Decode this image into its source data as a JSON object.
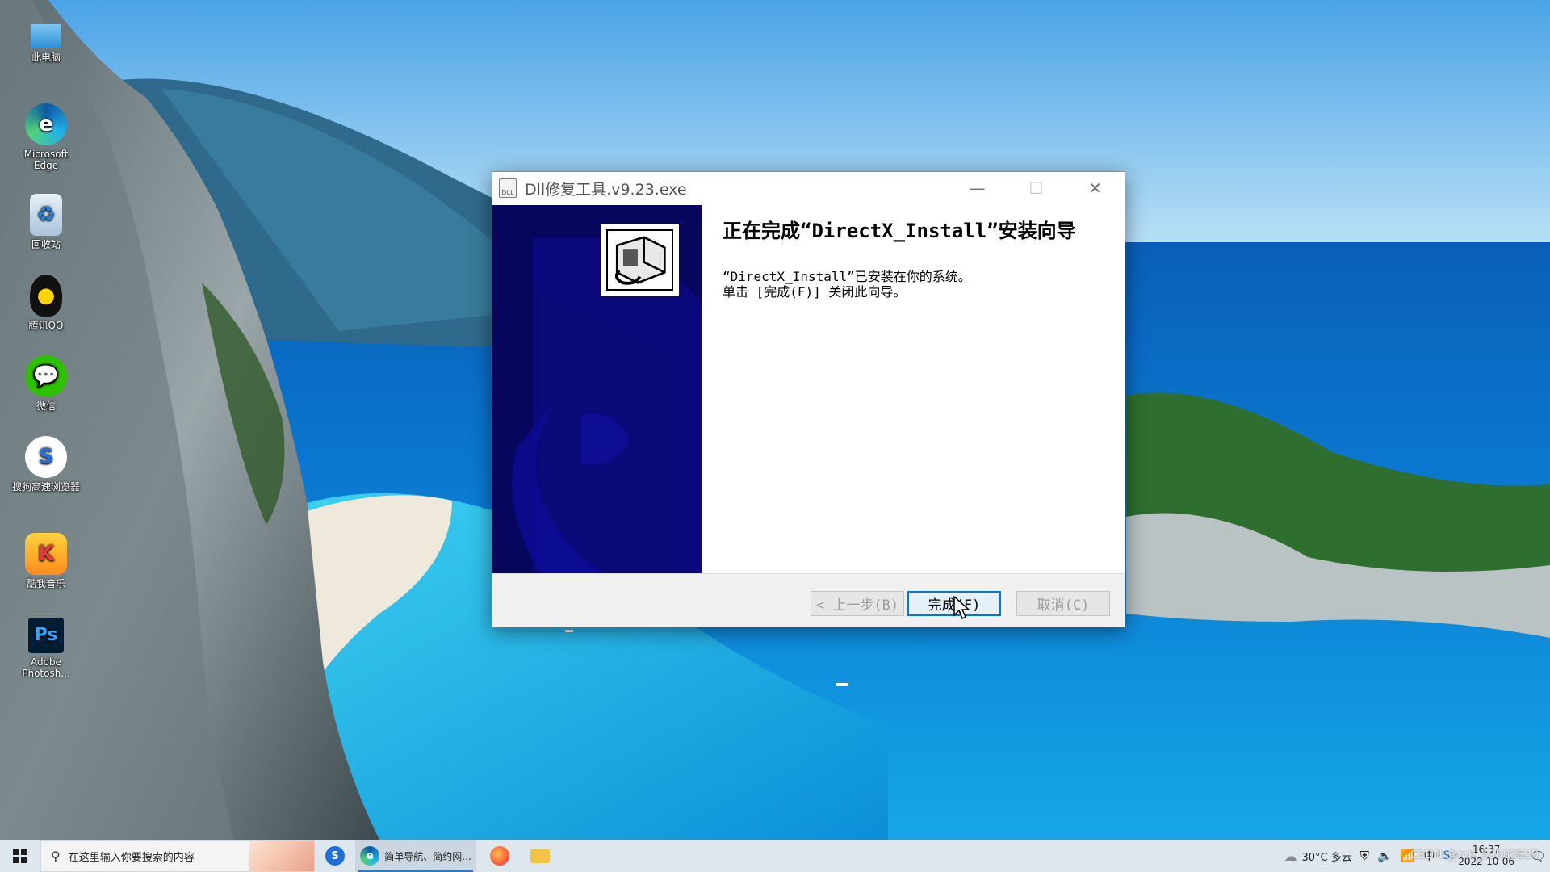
{
  "desktop": {
    "icons": [
      {
        "label": "此电脑"
      },
      {
        "label": "Microsoft Edge"
      },
      {
        "label": "回收站"
      },
      {
        "label": "腾讯QQ"
      },
      {
        "label": "微信"
      },
      {
        "label": "搜狗高速浏览器"
      },
      {
        "label": "酷我音乐"
      },
      {
        "label": "Adobe Photosh..."
      }
    ]
  },
  "window": {
    "title": "Dll修复工具.v9.23.exe",
    "minimize_glyph": "—",
    "maximize_glyph": "☐",
    "close_glyph": "✕",
    "heading": "正在完成“DirectX_Install”安装向导",
    "body_line1": "“DirectX_Install”已安装在你的系统。",
    "body_line2": "单击 [完成(F)] 关闭此向导。",
    "buttons": {
      "back": "< 上一步(B)",
      "finish": "完成(F)",
      "cancel": "取消(C)"
    }
  },
  "taskbar": {
    "search_placeholder": "在这里输入你要搜索的内容",
    "active_app_label": "简单导航、简约网...",
    "weather": "30°C 多云",
    "time": "16:37",
    "date": "2022-10-06"
  },
  "watermark": "CSDN @m0_55583820"
}
